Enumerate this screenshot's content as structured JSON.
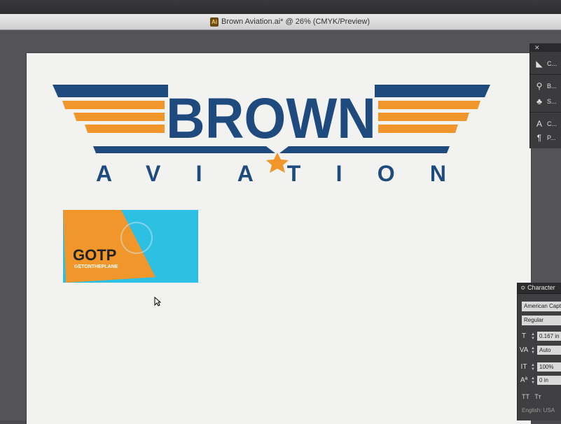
{
  "window": {
    "title": "Brown Aviation.ai* @ 26% (CMYK/Preview)",
    "app_icon_text": "Ai"
  },
  "artwork": {
    "logo_line1": "BROWN",
    "logo_line2": "AVIATION",
    "brand_colors": {
      "navy": "#1e4a7e",
      "orange": "#f0962a",
      "cyan": "#2ec0e2"
    },
    "card_logo_text": "GOTP",
    "card_tagline": "GETONTHEPLANE"
  },
  "panels": {
    "tools": [
      {
        "icon": "layers-icon",
        "label": "C..."
      },
      {
        "icon": "brush-icon",
        "label": "B..."
      },
      {
        "icon": "club-icon",
        "label": "S..."
      },
      {
        "icon": "character-icon",
        "label": "C..."
      },
      {
        "icon": "paragraph-icon",
        "label": "P..."
      }
    ],
    "character": {
      "title": "Character",
      "font_family": "American Capta",
      "font_style": "Regular",
      "font_size": "0.167 in",
      "tracking": "Auto",
      "vertical_scale": "100%",
      "baseline_shift": "0 in",
      "tt1": "TT",
      "tt2": "Tт",
      "language": "English: USA"
    }
  }
}
